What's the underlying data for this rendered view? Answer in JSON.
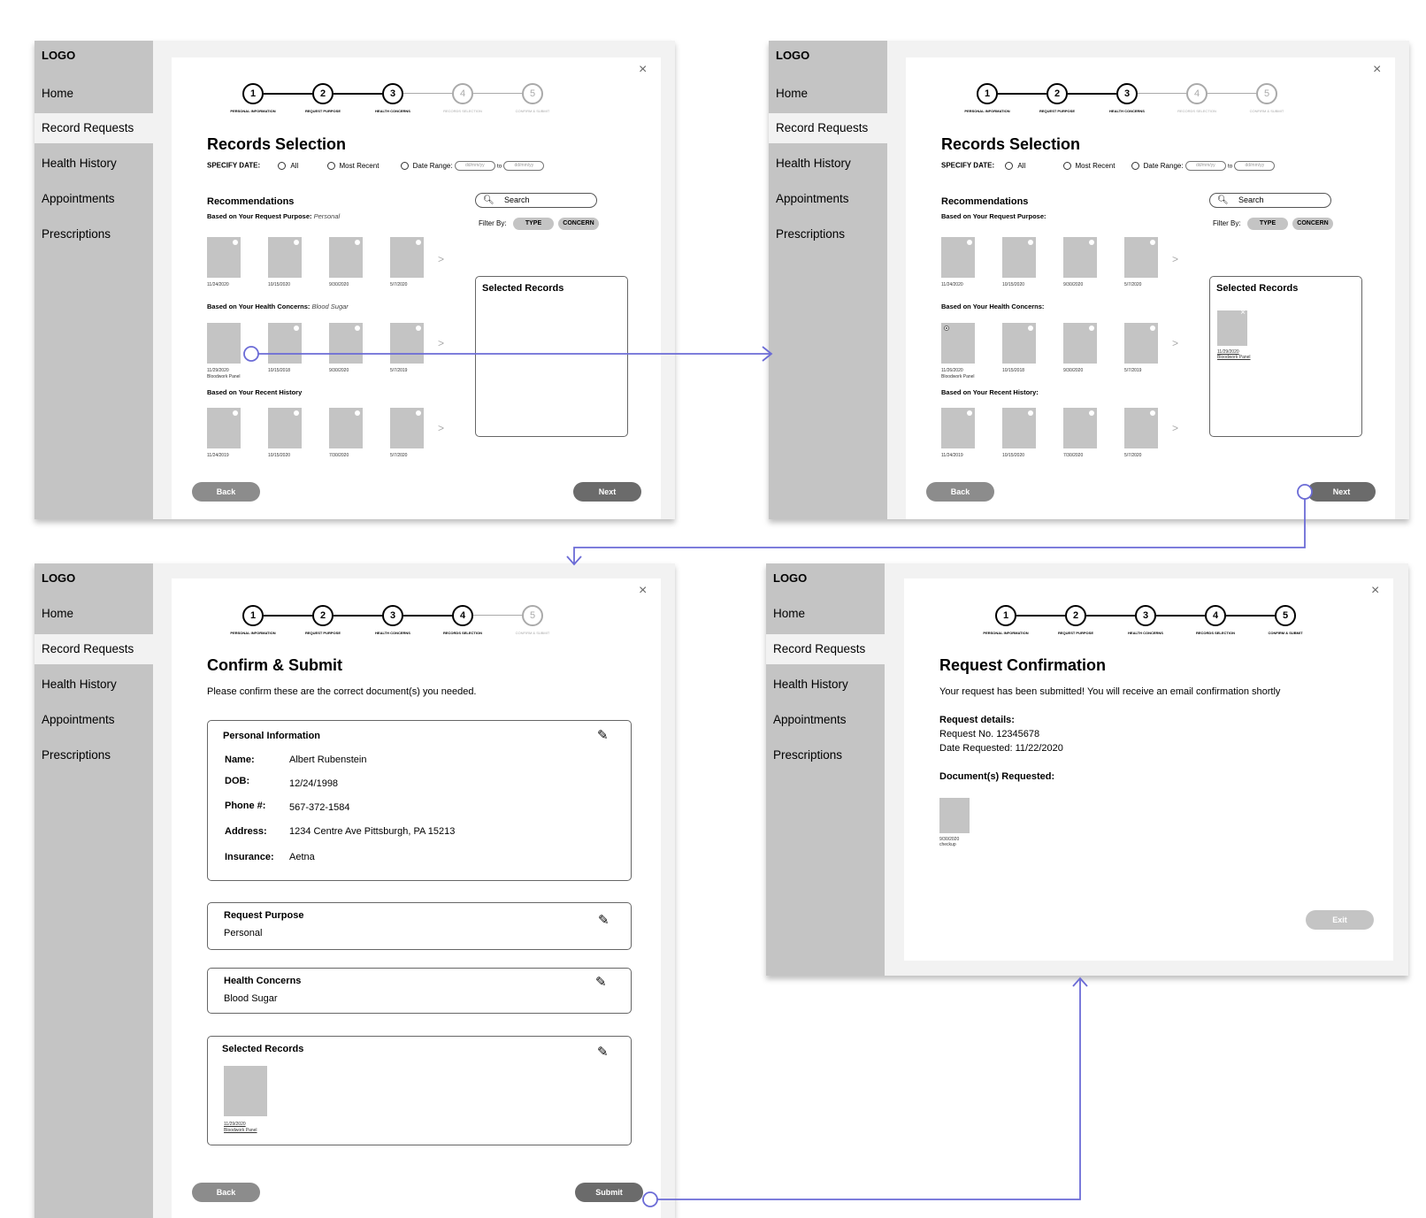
{
  "nav": {
    "logo": "LOGO",
    "items": [
      "Home",
      "Record Requests",
      "Health History",
      "Appointments",
      "Prescriptions"
    ]
  },
  "close_glyph": "×",
  "steps": [
    {
      "num": "1",
      "label": "PERSONAL INFORMATION"
    },
    {
      "num": "2",
      "label": "REQUEST PURPOSE"
    },
    {
      "num": "3",
      "label": "HEALTH CONCERNS"
    },
    {
      "num": "4",
      "label": "RECORDS SELECTION"
    },
    {
      "num": "5",
      "label": "CONFIRM & SUBMIT"
    }
  ],
  "records_selection": {
    "title": "Records Selection",
    "specify_date": "SPECIFY DATE:",
    "opt_all": "All",
    "opt_recent": "Most Recent",
    "opt_range": "Date Range:",
    "date_placeholder": "dd/mm/yy",
    "to": "to",
    "recommendations": "Recommendations",
    "purpose_label": "Based on Your Request Purpose:",
    "purpose_value": "Personal",
    "concerns_label": "Based on Your Health Concerns:",
    "concerns_value": "Blood Sugar",
    "history_label": "Based on Your Recent History",
    "history_label_2": "Based on Your Recent History:",
    "search_placeholder": "Search",
    "filter_by": "Filter By:",
    "filter_type": "TYPE",
    "filter_concern": "CONCERN",
    "selected_records": "Selected Records",
    "row1_dates": [
      "11/24/2020",
      "10/15/2020",
      "9/30/2020",
      "5/7/2020"
    ],
    "row2_dates": [
      "11/29/2020",
      "10/15/2018",
      "9/30/2020",
      "5/7/2019"
    ],
    "row2_dates_b": [
      "11/26/2020",
      "10/15/2018",
      "9/30/2020",
      "5/7/2019"
    ],
    "row2_sub": "Bloodwork Panel",
    "row3_dates": [
      "11/24/2019",
      "10/15/2020",
      "7/30/2020",
      "5/7/2020"
    ],
    "selected_item_date": "11/29/2020",
    "selected_item_name": "Bloodwork Panel",
    "chevron": ">",
    "back": "Back",
    "next": "Next"
  },
  "confirm_submit": {
    "title": "Confirm & Submit",
    "subtitle": "Please confirm these are the correct document(s) you needed.",
    "personal_info": "Personal Information",
    "name_label": "Name:",
    "name_value": "Albert Rubenstein",
    "dob_label": "DOB:",
    "dob_value": "12/24/1998",
    "phone_label": "Phone #:",
    "phone_value": "567-372-1584",
    "address_label": "Address:",
    "address_value": "1234 Centre Ave Pittsburgh, PA 15213",
    "insurance_label": "Insurance:",
    "insurance_value": "Aetna",
    "request_purpose": "Request Purpose",
    "request_purpose_value": "Personal",
    "health_concerns": "Health Concerns",
    "health_concerns_value": "Blood Sugar",
    "selected_records": "Selected Records",
    "record_date": "11/29/2020",
    "record_name": "Bloodwork Panel",
    "back": "Back",
    "submit": "Submit"
  },
  "request_confirmation": {
    "title": "Request Confirmation",
    "message": "Your request has been submitted! You will receive an email confirmation shortly",
    "details_label": "Request details:",
    "request_no": "Request No. 12345678",
    "date_requested": "Date Requested: 11/22/2020",
    "docs_label": "Document(s) Requested:",
    "doc_date": "9/30/2020",
    "doc_name": "checkup",
    "exit": "Exit"
  },
  "flow_color": "#6b6bd6",
  "icons": {
    "search": "search-icon",
    "pencil": "pencil-icon",
    "close": "close-icon"
  }
}
